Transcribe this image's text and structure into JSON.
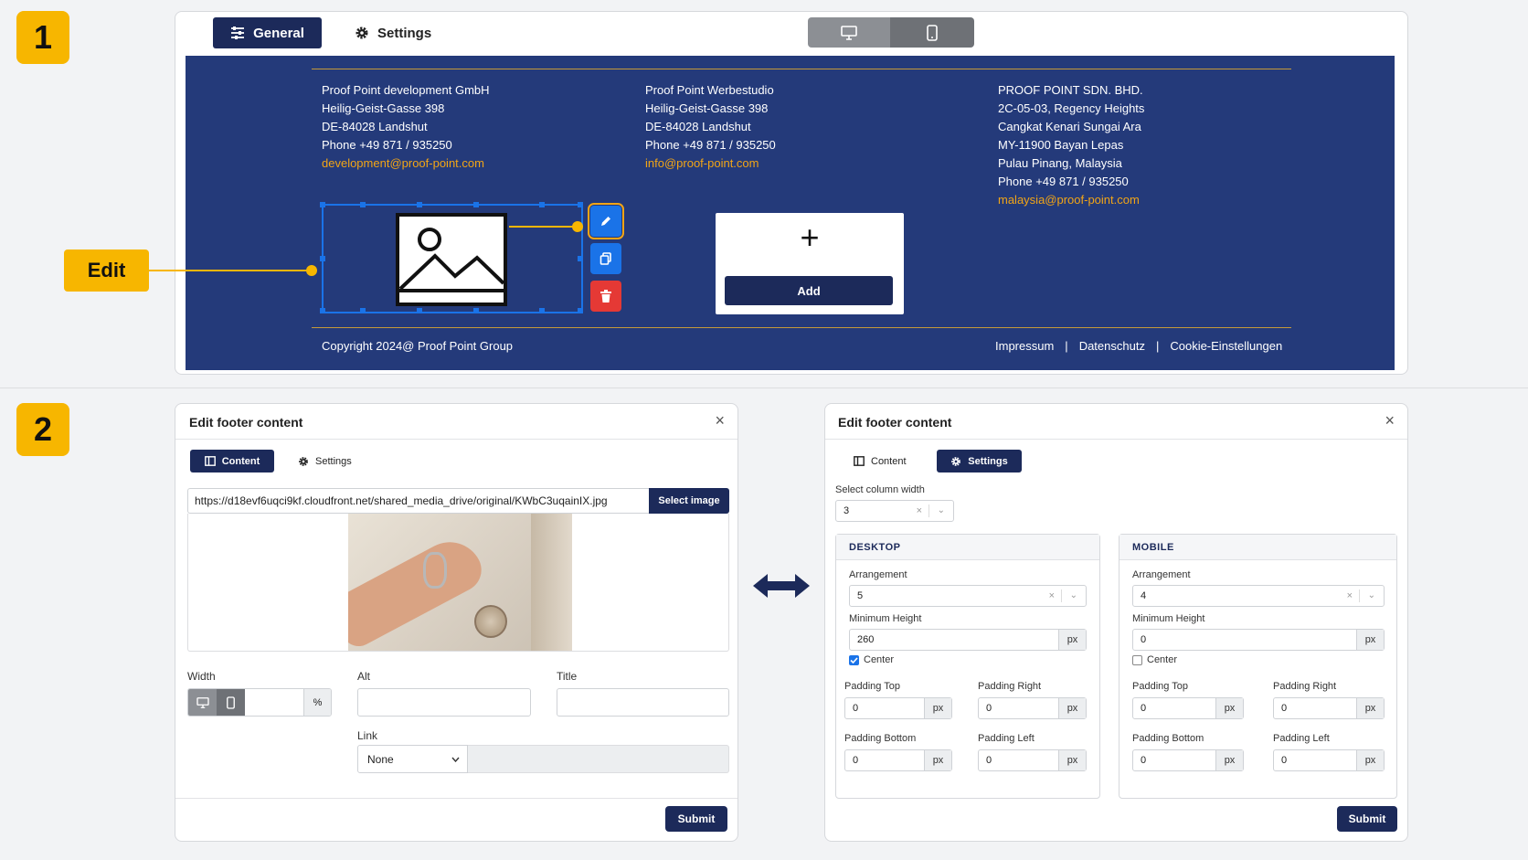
{
  "steps": {
    "one": "1",
    "two": "2"
  },
  "edit_callout": "Edit",
  "editor": {
    "tabs": {
      "general": "General",
      "settings": "Settings"
    },
    "device_toggle": [
      "desktop-icon",
      "mobile-icon"
    ],
    "footer": {
      "col1": [
        "Proof Point development GmbH",
        "Heilig-Geist-Gasse 398",
        "DE-84028 Landshut",
        "Phone +49 871 / 935250"
      ],
      "col1_email": "development@proof-point.com",
      "col2": [
        "Proof Point Werbestudio",
        "Heilig-Geist-Gasse 398",
        "DE-84028 Landshut",
        "Phone +49 871 / 935250"
      ],
      "col2_email": "info@proof-point.com",
      "col3": [
        "PROOF POINT SDN. BHD.",
        "2C-05-03, Regency Heights",
        "Cangkat Kenari Sungai Ara",
        "MY-11900 Bayan Lepas",
        "Pulau Pinang, Malaysia",
        "Phone +49 871 / 935250"
      ],
      "col3_email": "malaysia@proof-point.com",
      "add_plus": "+",
      "add_label": "Add",
      "copyright": "Copyright 2024@ Proof Point Group",
      "links": [
        "Impressum",
        "Datenschutz",
        "Cookie-Einstellungen"
      ],
      "link_sep": "|"
    },
    "action_icons": [
      "pencil-icon",
      "copy-icon",
      "trash-icon"
    ]
  },
  "dialog_content": {
    "title": "Edit footer content",
    "close": "×",
    "tabs": {
      "content": "Content",
      "settings": "Settings"
    },
    "url": "https://d18evf6uqci9kf.cloudfront.net/shared_media_drive/original/KWbC3uqainIX.jpg",
    "select_image": "Select image",
    "width_label": "Width",
    "width_unit": "%",
    "width_value": "",
    "alt_label": "Alt",
    "alt_value": "",
    "title_label": "Title",
    "title_value": "",
    "link_label": "Link",
    "link_value": "None",
    "submit": "Submit"
  },
  "arrow": "⟷",
  "dialog_settings": {
    "title": "Edit footer content",
    "close": "×",
    "tabs": {
      "content": "Content",
      "settings": "Settings"
    },
    "column_width_label": "Select column width",
    "column_width_value": "3",
    "desktop": {
      "heading": "DESKTOP",
      "arrangement_label": "Arrangement",
      "arrangement_value": "5",
      "min_height_label": "Minimum Height",
      "min_height_value": "260",
      "center_label": "Center",
      "center_checked": true,
      "padding_top_label": "Padding Top",
      "padding_top": "0",
      "padding_right_label": "Padding Right",
      "padding_right": "0",
      "padding_bottom_label": "Padding Bottom",
      "padding_bottom": "0",
      "padding_left_label": "Padding Left",
      "padding_left": "0"
    },
    "mobile": {
      "heading": "MOBILE",
      "arrangement_label": "Arrangement",
      "arrangement_value": "4",
      "min_height_label": "Minimum Height",
      "min_height_value": "0",
      "center_label": "Center",
      "center_checked": false,
      "padding_top_label": "Padding Top",
      "padding_top": "0",
      "padding_right_label": "Padding Right",
      "padding_right": "0",
      "padding_bottom_label": "Padding Bottom",
      "padding_bottom": "0",
      "padding_left_label": "Padding Left",
      "padding_left": "0"
    },
    "unit": "px",
    "submit": "Submit"
  },
  "colors": {
    "navy": "#1c2a5a",
    "footer_bg": "#243a7a",
    "accent": "#f7b600",
    "link_orange": "#f2a516",
    "blue": "#1a73e8",
    "red": "#e53935"
  }
}
